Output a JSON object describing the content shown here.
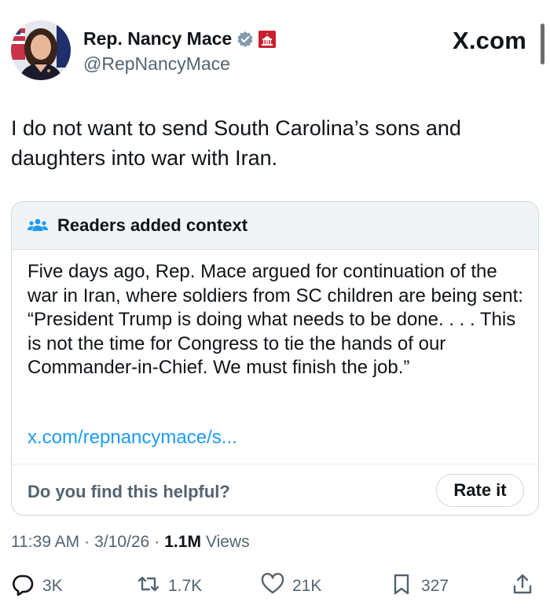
{
  "author": {
    "display_name": "Rep. Nancy Mace",
    "handle": "@RepNancyMace",
    "badge_icon": "verified-badge-icon",
    "affiliation_icon": "capitol-icon"
  },
  "brand": "X.com",
  "tweet": {
    "text": "I do not want to send South Carolina’s sons and daughters into war with Iran."
  },
  "community_note": {
    "title": "Readers added context",
    "icon": "people-icon",
    "body": "Five days ago, Rep. Mace argued for continuation of the war in Iran, where soldiers from SC children are being sent: “President Trump is doing what needs to be done. . . . This is not the time for Congress to tie the hands of our Commander-in-Chief. We must finish the job.”",
    "link": "x.com/repnancymace/s...",
    "helpful_prompt": "Do you find this helpful?",
    "rate_label": "Rate it"
  },
  "meta": {
    "time": "11:39 AM",
    "sep1": "·",
    "date": "3/10/26",
    "sep2": "·",
    "views_count": "1.1M",
    "views_label": "Views"
  },
  "actions": {
    "replies": "3K",
    "reposts": "1.7K",
    "likes": "21K",
    "bookmarks": "327"
  },
  "colors": {
    "text": "#0f1419",
    "secondary": "#536471",
    "link": "#1d9bf0",
    "verified": "#829aab",
    "note_header_bg": "#f1f4f5"
  }
}
